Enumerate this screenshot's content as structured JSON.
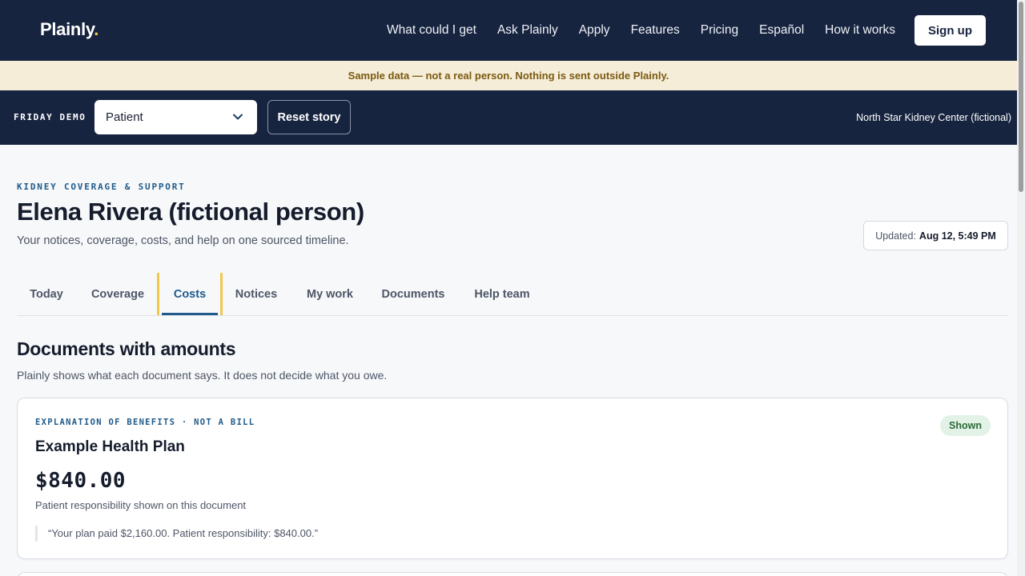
{
  "brand": {
    "name": "Plainly",
    "dot": "."
  },
  "nav": {
    "links": [
      "What could I get",
      "Ask Plainly",
      "Apply",
      "Features",
      "Pricing",
      "Español",
      "How it works"
    ],
    "signup_label": "Sign up"
  },
  "banner": {
    "text": "Sample data — not a real person. Nothing is sent outside Plainly."
  },
  "demo": {
    "label": "FRIDAY DEMO",
    "role_selected": "Patient",
    "reset_label": "Reset story",
    "center": "North Star Kidney Center (fictional)"
  },
  "header": {
    "eyebrow": "KIDNEY COVERAGE & SUPPORT",
    "person": "Elena Rivera (fictional person)",
    "subtitle": "Your notices, coverage, costs, and help on one sourced timeline.",
    "updated_label": "Updated:",
    "updated_value": "Aug 12, 5:49 PM"
  },
  "tabs": [
    "Today",
    "Coverage",
    "Costs",
    "Notices",
    "My work",
    "Documents",
    "Help team"
  ],
  "active_tab": "Costs",
  "section": {
    "title": "Documents with amounts",
    "subtitle": "Plainly shows what each document says. It does not decide what you owe."
  },
  "card": {
    "eyebrow": "EXPLANATION OF BENEFITS · NOT A BILL",
    "title": "Example Health Plan",
    "badge": "Shown",
    "amount": "$840.00",
    "amount_note": "Patient responsibility shown on this document",
    "quote": "“Your plan paid $2,160.00. Patient responsibility: $840.00.”"
  },
  "colors": {
    "navy": "#172440",
    "accent_yellow": "#f2c84b",
    "link_blue": "#1f5a8a",
    "banner_bg": "#f6edd8",
    "badge_green": "#e3f2e6"
  },
  "icons": {
    "role_select": "chevron-down-icon"
  }
}
